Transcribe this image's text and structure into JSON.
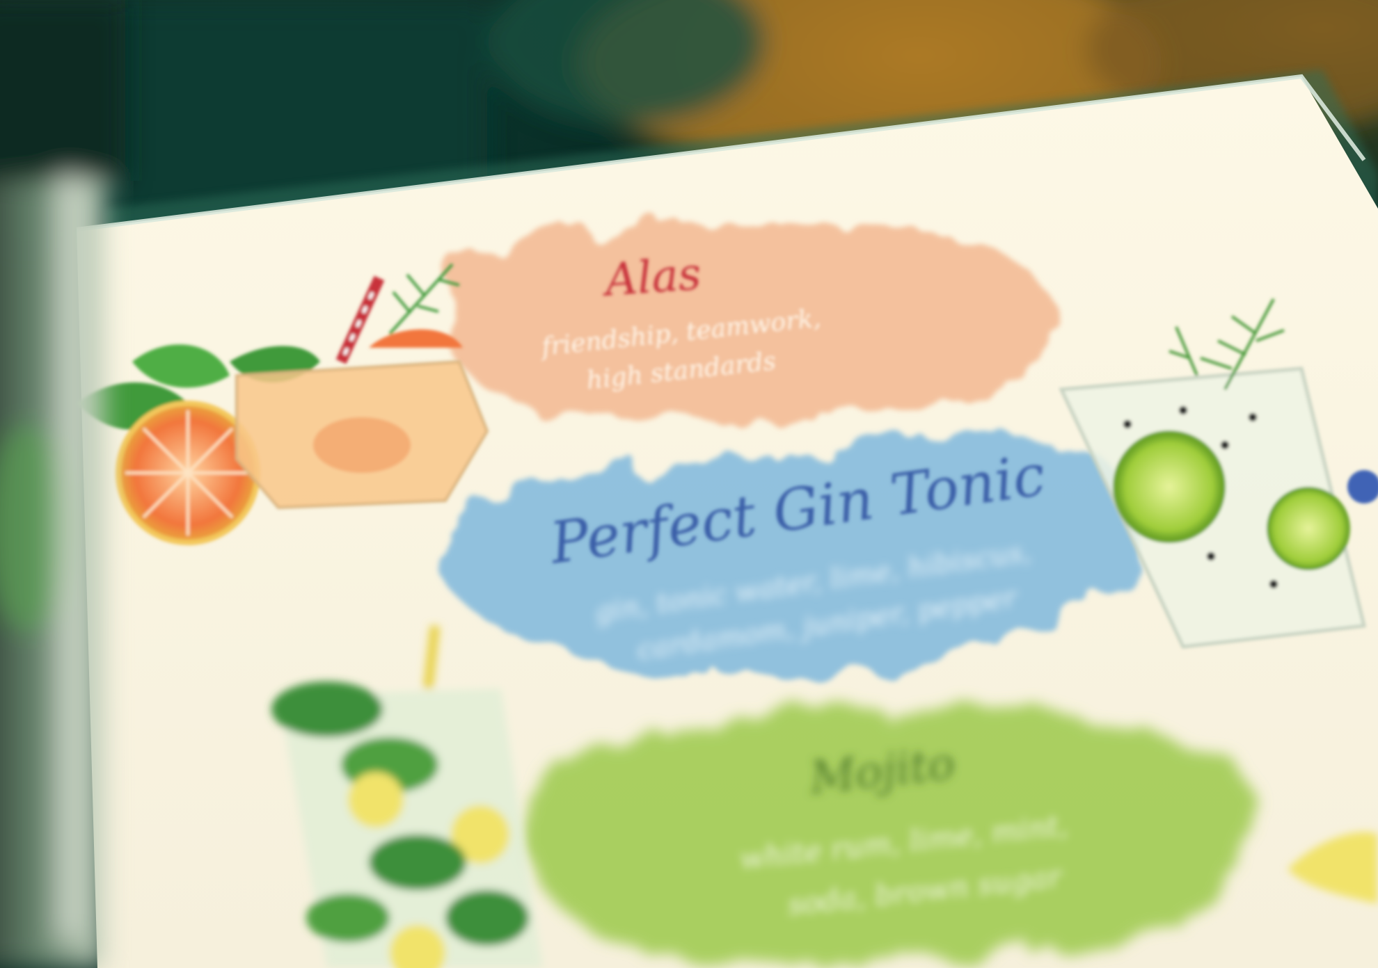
{
  "menu": {
    "items": [
      {
        "name": "Alas",
        "description_lines": [
          "friendship, teamwork,",
          "high standards"
        ]
      },
      {
        "name": "Perfect Gin Tonic",
        "description_lines": [
          "gin, tonic water, lime, hibiscus,",
          "cardamom, juniper, pepper"
        ]
      },
      {
        "name": "Mojito",
        "description_lines": [
          "white rum, lime, mint,",
          "soda, brown sugar"
        ]
      }
    ]
  },
  "colors": {
    "alas_title": "#c8323a",
    "alas_wash": "#f2b48c",
    "gin_title": "#3a5fa8",
    "gin_wash": "#6fb0dc",
    "mojito_title": "#4f7a2a",
    "mojito_wash": "#9cc94a",
    "paper": "#fbf7e8"
  },
  "icons": {
    "alas": "grapefruit-cocktail-icon",
    "gin": "gin-tonic-glass-icon",
    "mojito": "mojito-glass-icon"
  }
}
